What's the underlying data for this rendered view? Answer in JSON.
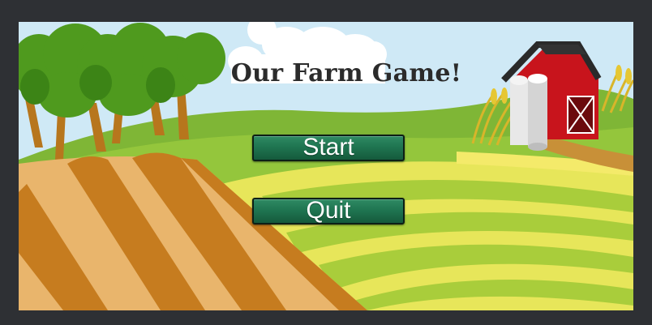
{
  "game": {
    "title": "Our Farm Game!",
    "buttons": {
      "start_label": "Start",
      "quit_label": "Quit"
    }
  },
  "colors": {
    "background": "#2e3034",
    "sky": "#cfe9f6",
    "button": "#1f7551",
    "button_border": "#0d1f16",
    "barn": "#c8141c",
    "field_yellow": "#f6e35a",
    "field_green": "#9cc63a"
  },
  "scene_objects": [
    "cloud",
    "tree-grove",
    "barn",
    "silo",
    "wheat",
    "plowed-field",
    "striped-fields"
  ]
}
